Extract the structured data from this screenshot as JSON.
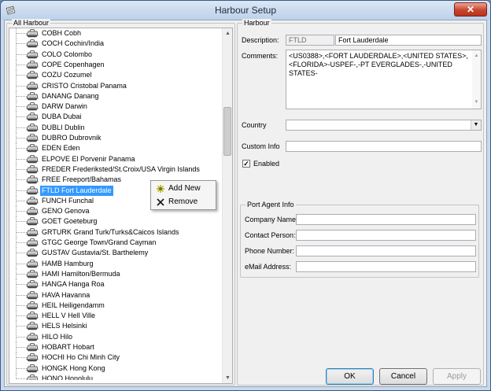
{
  "window": {
    "title": "Harbour Setup",
    "close_label": "✕"
  },
  "tree": {
    "group_label": "All Harbour",
    "selected_index": 15,
    "items": [
      {
        "code": "COBH",
        "name": "Cobh"
      },
      {
        "code": "COCH",
        "name": "Cochin/India"
      },
      {
        "code": "COLO",
        "name": "Colombo"
      },
      {
        "code": "COPE",
        "name": "Copenhagen"
      },
      {
        "code": "COZU",
        "name": "Cozumel"
      },
      {
        "code": "CRISTO",
        "name": "Cristobal Panama"
      },
      {
        "code": "DANANG",
        "name": "Danang"
      },
      {
        "code": "DARW",
        "name": "Darwin"
      },
      {
        "code": "DUBA",
        "name": "Dubai"
      },
      {
        "code": "DUBLI",
        "name": "Dublin"
      },
      {
        "code": "DUBRO",
        "name": "Dubrovnik"
      },
      {
        "code": "EDEN",
        "name": "Eden"
      },
      {
        "code": "ELPOVE",
        "name": "El Porvenir Panama"
      },
      {
        "code": "FREDER",
        "name": "Frederiksted/St.Croix/USA Virgin Islands"
      },
      {
        "code": "FREE",
        "name": "Freeport/Bahamas"
      },
      {
        "code": "FTLD",
        "name": "Fort Lauderdale"
      },
      {
        "code": "FUNCH",
        "name": "Funchal"
      },
      {
        "code": "GENO",
        "name": "Genova"
      },
      {
        "code": "GOET",
        "name": "Goeteburg"
      },
      {
        "code": "GRTURK",
        "name": "Grand Turk/Turks&Caicos Islands"
      },
      {
        "code": "GTGC",
        "name": "George Town/Grand Cayman"
      },
      {
        "code": "GUSTAV",
        "name": "Gustavia/St. Barthelemy"
      },
      {
        "code": "HAMB",
        "name": "Hamburg"
      },
      {
        "code": "HAMI",
        "name": "Hamilton/Bermuda"
      },
      {
        "code": "HANGA",
        "name": "Hanga Roa"
      },
      {
        "code": "HAVA",
        "name": "Havanna"
      },
      {
        "code": "HEIL",
        "name": "Heiligendamm"
      },
      {
        "code": "HELL V",
        "name": "Hell Ville"
      },
      {
        "code": "HELS",
        "name": "Helsinki"
      },
      {
        "code": "HILO",
        "name": "Hilo"
      },
      {
        "code": "HOBART",
        "name": "Hobart"
      },
      {
        "code": "HOCHI",
        "name": "Ho Chi Minh City"
      },
      {
        "code": "HONGK",
        "name": "Hong Kong"
      },
      {
        "code": "HONO",
        "name": "Honolulu"
      }
    ]
  },
  "context_menu": {
    "add_label": "Add New",
    "remove_label": "Remove"
  },
  "harbour": {
    "group_label": "Harbour",
    "description_label": "Description:",
    "code_value": "FTLD",
    "description_value": "Fort Lauderdale",
    "comments_label": "Comments:",
    "comments_value": "<US0388>,<FORT LAUDERDALE>,<UNITED STATES>,<FLORIDA>-USPEF-,-PT EVERGLADES-,-UNITED STATES-",
    "country_label": "Country",
    "country_value": "",
    "custom_info_label": "Custom Info",
    "custom_info_value": "",
    "enabled_label": "Enabled",
    "enabled_checked": true,
    "check_mark": "✓"
  },
  "port_agent": {
    "group_label": "Port Agent Info",
    "company_label": "Company Name:",
    "company_value": "",
    "contact_label": "Contact Person:",
    "contact_value": "",
    "phone_label": "Phone Number:",
    "phone_value": "",
    "email_label": "eMail Address:",
    "email_value": ""
  },
  "buttons": {
    "ok_label": "OK",
    "cancel_label": "Cancel",
    "apply_label": "Apply"
  },
  "colors": {
    "selection": "#3399ff",
    "window_frame": "#c9d9ec"
  }
}
